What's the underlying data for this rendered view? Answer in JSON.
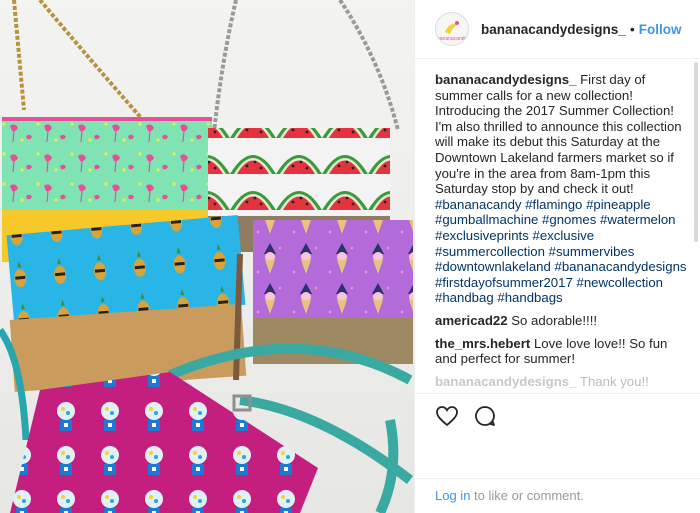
{
  "post": {
    "photo_alt": "bags",
    "account": {
      "username": "bananacandydesigns_",
      "separator": "•",
      "follow_label": "Follow",
      "avatar_text": "bananacandy"
    },
    "caption": {
      "username": "bananacandydesigns_",
      "text": "First day of summer calls for a new collection! Introducing the 2017 Summer Collection! I'm also thrilled to announce this collection will make its debut this Saturday at the Downtown Lakeland farmers market so if you're in the area from 8am-1pm this Saturday stop by and check it out!",
      "hashtags": [
        "#bananacandy",
        "#flamingo",
        "#pineapple",
        "#gumballmachine",
        "#gnomes",
        "#watermelon",
        "#exclusiveprints",
        "#exclusive",
        "#summercollection",
        "#summervibes",
        "#downtownlakeland",
        "#bananacandydesigns",
        "#firstdayofsummer2017",
        "#newcollection",
        "#handbag",
        "#handbags"
      ]
    },
    "comments": [
      {
        "user": "americad22",
        "text": "So adorable!!!!"
      },
      {
        "user": "the_mrs.hebert",
        "text": "Love love love!! So fun and perfect for summer!"
      },
      {
        "user": "bananacandydesigns_",
        "text": "Thank you!!"
      }
    ],
    "footer": {
      "login_label": "Log in",
      "rest": "to like or comment."
    },
    "colors": {
      "link_blue": "#3897f0",
      "hashtag": "#003569",
      "text": "#262626"
    }
  }
}
